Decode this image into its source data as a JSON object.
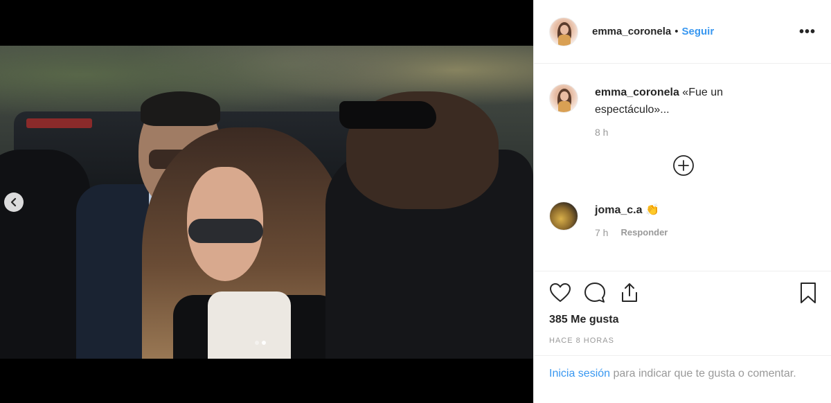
{
  "post": {
    "author": "emma_coronela",
    "separator": "•",
    "follow_label": "Seguir",
    "more_label": "•••"
  },
  "media": {
    "carousel_count": 2,
    "carousel_active_index": 1
  },
  "comments": [
    {
      "username": "emma_coronela",
      "text": "«Fue un espectáculo»...",
      "time": "8 h"
    },
    {
      "username": "joma_c.a",
      "text": "👏",
      "time": "7 h",
      "reply_label": "Responder"
    }
  ],
  "actions": {
    "likes": "385 Me gusta",
    "posted_ago": "HACE 8 HORAS"
  },
  "login": {
    "link": "Inicia sesión",
    "rest": " para indicar que te gusta o comentar."
  },
  "colors": {
    "accent": "#3897f0",
    "muted": "#999999",
    "text": "#262626",
    "divider": "#efefef"
  }
}
